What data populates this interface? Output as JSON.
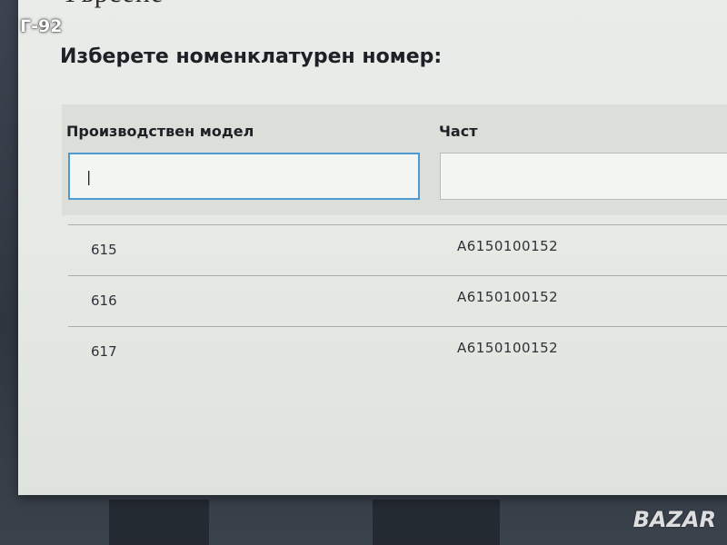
{
  "page": {
    "heading_partial": "Търсене",
    "prompt": "Изберете номенклатурен номер:"
  },
  "filters": {
    "model_label": "Производствен модел",
    "model_value": "|",
    "part_label": "Част",
    "part_value": ""
  },
  "results": [
    {
      "model": "615",
      "part": "A6150100152"
    },
    {
      "model": "616",
      "part": "A6150100152"
    },
    {
      "model": "617",
      "part": "A6150100152"
    }
  ],
  "overlay": {
    "badge": "Г-92",
    "watermark": "BAZAR"
  }
}
